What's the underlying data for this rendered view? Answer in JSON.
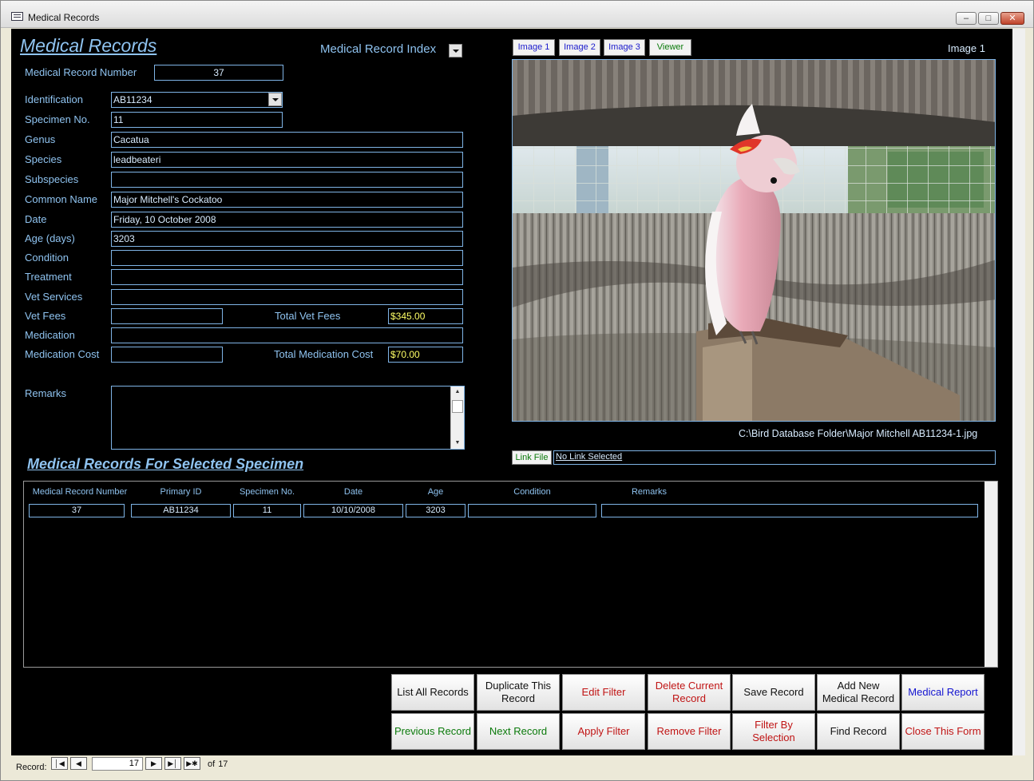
{
  "window": {
    "title": "Medical Records"
  },
  "form": {
    "header": "Medical Records",
    "index_label": "Medical Record Index",
    "record_number": {
      "label": "Medical Record Number",
      "value": "37"
    },
    "fields": {
      "identification": {
        "label": "Identification",
        "value": "AB11234"
      },
      "specimen_no": {
        "label": "Specimen No.",
        "value": "11"
      },
      "genus": {
        "label": "Genus",
        "value": "Cacatua"
      },
      "species": {
        "label": "Species",
        "value": "leadbeateri"
      },
      "subspecies": {
        "label": "Subspecies",
        "value": ""
      },
      "common_name": {
        "label": "Common Name",
        "value": "Major Mitchell's Cockatoo"
      },
      "date": {
        "label": "Date",
        "value": "Friday, 10 October 2008"
      },
      "age": {
        "label": "Age (days)",
        "value": "3203"
      },
      "condition": {
        "label": "Condition",
        "value": ""
      },
      "treatment": {
        "label": "Treatment",
        "value": ""
      },
      "vet_services": {
        "label": "Vet Services",
        "value": ""
      },
      "vet_fees": {
        "label": "Vet Fees",
        "value": ""
      },
      "total_vet_fees": {
        "label": "Total Vet Fees",
        "value": "$345.00"
      },
      "medication": {
        "label": "Medication",
        "value": ""
      },
      "medication_cost": {
        "label": "Medication Cost",
        "value": ""
      },
      "total_medication_cost": {
        "label": "Total Medication Cost",
        "value": "$70.00"
      },
      "remarks": {
        "label": "Remarks",
        "value": ""
      }
    },
    "image_tabs": [
      "Image 1",
      "Image 2",
      "Image 3",
      "Viewer"
    ],
    "image_label": "Image 1",
    "image_path": "C:\\Bird Database Folder\\Major Mitchell AB11234-1.jpg",
    "link_button": "Link File",
    "link_value": "No Link Selected",
    "subform_title": "Medical Records For Selected Specimen",
    "subform": {
      "columns": [
        "Medical Record Number",
        "Primary ID",
        "Specimen No.",
        "Date",
        "Age",
        "Condition",
        "Remarks"
      ],
      "rows": [
        [
          "37",
          "AB11234",
          "11",
          "10/10/2008",
          "3203",
          "",
          ""
        ]
      ]
    },
    "commands": {
      "list_all": "List All Records",
      "duplicate": "Duplicate This Record",
      "edit_filter": "Edit Filter",
      "delete_current": "Delete Current Record",
      "save": "Save Record",
      "add_new": "Add New Medical Record",
      "medical_report": "Medical Report",
      "previous": "Previous Record",
      "next": "Next Record",
      "apply_filter": "Apply Filter",
      "remove_filter": "Remove Filter",
      "filter_by_selection": "Filter By Selection",
      "find": "Find Record",
      "close_form": "Close This Form"
    }
  },
  "navigation": {
    "label": "Record:",
    "current": "17",
    "of_label": "of",
    "total": "17"
  },
  "colors": {
    "form_bg": "#000000",
    "label": "#8fc3f0",
    "field_border": "#7fb4e6",
    "money": "#ffff66"
  }
}
